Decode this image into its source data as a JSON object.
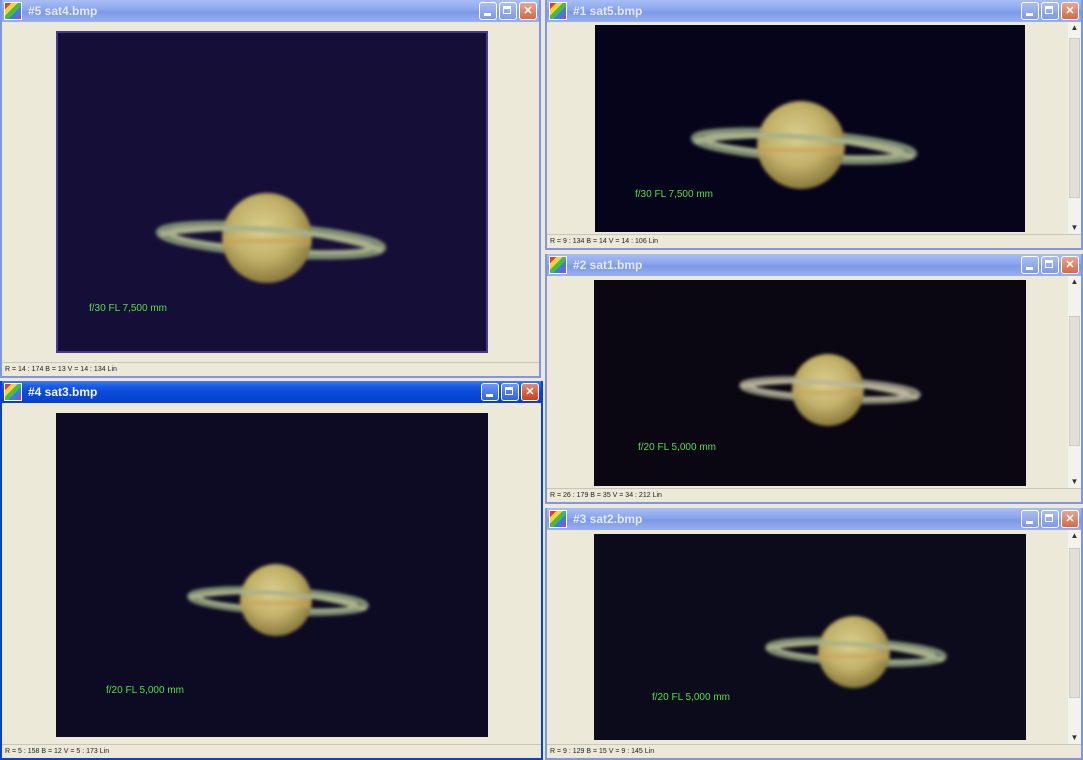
{
  "windows": [
    {
      "title": "#5 sat4.bmp",
      "caption": "f/30 FL 7,500 mm",
      "status": "R = 14 : 174   B = 13   V = 14 : 134 Lin"
    },
    {
      "title": "#4 sat3.bmp",
      "caption": "f/20  FL 5,000 mm",
      "status": "R = 5 : 158   B = 12   V = 5 : 173 Lin"
    },
    {
      "title": "#1 sat5.bmp",
      "caption": "f/30 FL 7,500 mm",
      "status": "R = 9 : 134   B = 14   V = 14 : 106 Lin"
    },
    {
      "title": "#2 sat1.bmp",
      "caption": "f/20  FL 5,000 mm",
      "status": "R = 26 : 179   B = 35   V = 34 : 212 Lin"
    },
    {
      "title": "#3 sat2.bmp",
      "caption": "f/20  FL 5,000 mm",
      "status": "R = 9 : 129   B = 15   V = 9 : 145 Lin"
    }
  ],
  "icons": {
    "app": "image-app-icon",
    "minimize": "minimize-icon",
    "maximize": "maximize-icon",
    "close": "close-icon",
    "scroll_up": "scroll-up-arrow-icon",
    "scroll_down": "scroll-down-arrow-icon"
  },
  "colors": {
    "caption_text": "#4ee04a",
    "image_background": "#0e0a22",
    "active_titlebar": "#0a4ad6",
    "inactive_titlebar": "#8aa5ec"
  }
}
